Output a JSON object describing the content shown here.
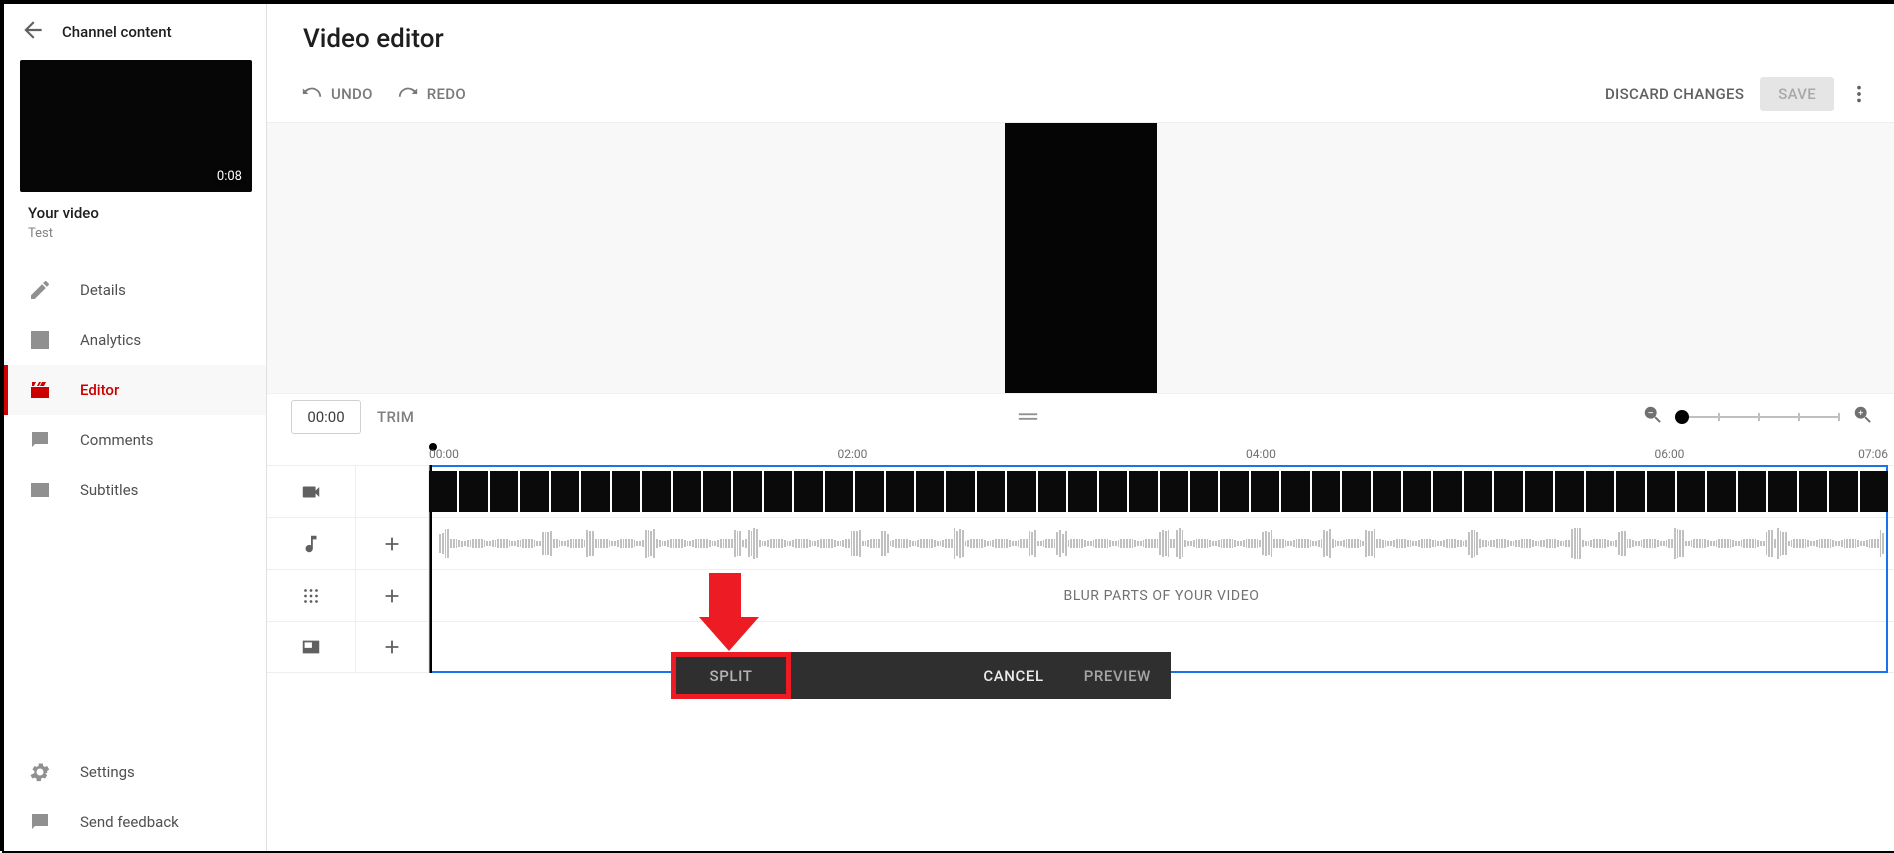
{
  "sidebar": {
    "back_label": "Channel content",
    "thumb_duration": "0:08",
    "meta_heading": "Your video",
    "meta_title": "Test",
    "items": [
      {
        "label": "Details"
      },
      {
        "label": "Analytics"
      },
      {
        "label": "Editor"
      },
      {
        "label": "Comments"
      },
      {
        "label": "Subtitles"
      }
    ],
    "footer": [
      {
        "label": "Settings"
      },
      {
        "label": "Send feedback"
      }
    ]
  },
  "header": {
    "title": "Video editor"
  },
  "toolbar": {
    "undo": "UNDO",
    "redo": "REDO",
    "discard": "DISCARD CHANGES",
    "save": "SAVE"
  },
  "controls": {
    "time_value": "00:00",
    "trim_label": "TRIM"
  },
  "timeline": {
    "ticks": [
      "00:00",
      "02:00",
      "04:00",
      "06:00",
      "07:06"
    ],
    "blur_hint": "BLUR PARTS OF YOUR VIDEO"
  },
  "actionbar": {
    "split": "SPLIT",
    "cancel": "CANCEL",
    "preview": "PREVIEW"
  }
}
